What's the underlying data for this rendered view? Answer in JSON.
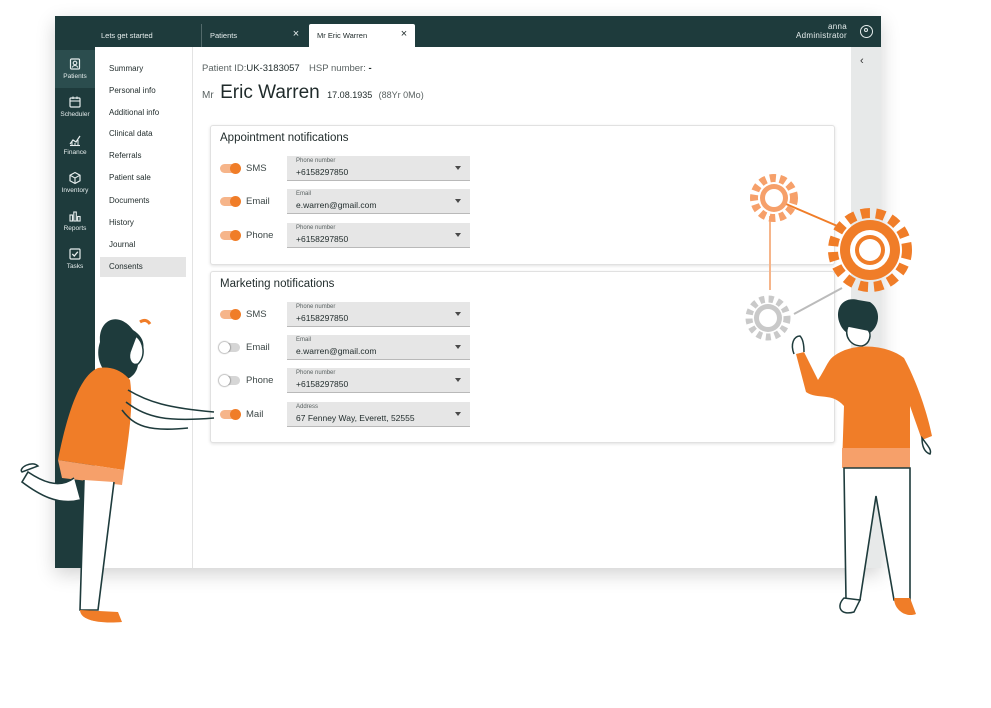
{
  "tabs": [
    {
      "label": "Lets get started"
    },
    {
      "label": "Patients"
    },
    {
      "label": "Mr Eric Warren"
    }
  ],
  "user": {
    "name": "anna",
    "role": "Administrator"
  },
  "nav": [
    {
      "label": "Patients",
      "icon": "patients-icon"
    },
    {
      "label": "Scheduler",
      "icon": "calendar-icon"
    },
    {
      "label": "Finance",
      "icon": "finance-icon"
    },
    {
      "label": "Inventory",
      "icon": "box-icon"
    },
    {
      "label": "Reports",
      "icon": "bar-chart-icon"
    },
    {
      "label": "Tasks",
      "icon": "checkbox-icon"
    }
  ],
  "subnav": [
    "Summary",
    "Personal info",
    "Additional info",
    "Clinical data",
    "Referrals",
    "Patient sale",
    "Documents",
    "History",
    "Journal",
    "Consents"
  ],
  "patient": {
    "id_label": "Patient ID:",
    "id": "UK-3183057",
    "hsp_label": "HSP number:",
    "hsp": "-",
    "prefix": "Mr",
    "name": "Eric Warren",
    "dob": "17.08.1935",
    "age": "(88Yr 0Mo)"
  },
  "appointment": {
    "title": "Appointment notifications",
    "rows": [
      {
        "label": "SMS",
        "on": true,
        "field_label": "Phone number",
        "value": "+6158297850"
      },
      {
        "label": "Email",
        "on": true,
        "field_label": "Email",
        "value": "e.warren@gmail.com"
      },
      {
        "label": "Phone",
        "on": true,
        "field_label": "Phone number",
        "value": "+6158297850"
      }
    ]
  },
  "marketing": {
    "title": "Marketing notifications",
    "rows": [
      {
        "label": "SMS",
        "on": true,
        "field_label": "Phone number",
        "value": "+6158297850"
      },
      {
        "label": "Email",
        "on": false,
        "field_label": "Email",
        "value": "e.warren@gmail.com"
      },
      {
        "label": "Phone",
        "on": false,
        "field_label": "Phone number",
        "value": "+6158297850"
      },
      {
        "label": "Mail",
        "on": true,
        "field_label": "Address",
        "value": "67 Fenney Way, Everett, 52555"
      }
    ]
  },
  "colors": {
    "accent": "#f07d28",
    "dark": "#1e3b3c"
  }
}
